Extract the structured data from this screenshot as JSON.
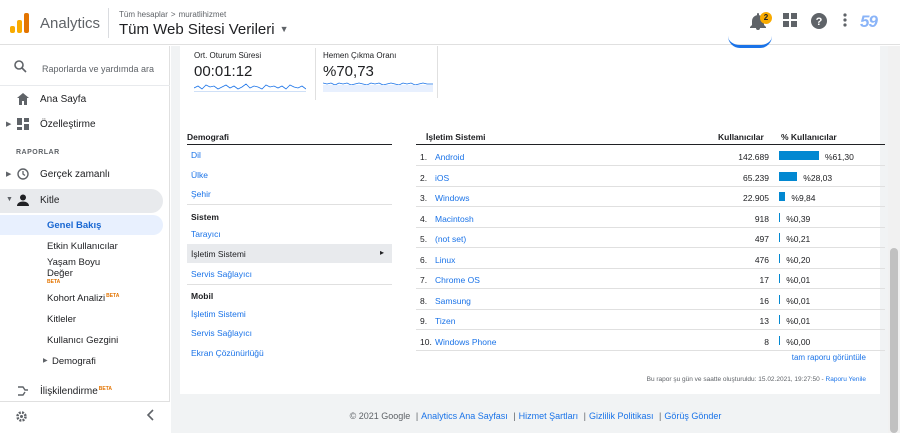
{
  "topbar": {
    "app_name": "Analytics",
    "breadcrumb": [
      "Tüm hesaplar",
      "muratlihizmet"
    ],
    "breadcrumb_separator": ">",
    "property": "Tüm Web Sitesi Verileri",
    "notification_count": "2",
    "account_badge": "59",
    "icons": [
      "bell-icon",
      "apps-grid-icon",
      "help-icon",
      "more-vert-icon"
    ]
  },
  "sidebar": {
    "search_placeholder": "Raporlarda ve yardımda ara",
    "items": [
      {
        "label": "Ana Sayfa",
        "icon": "home-icon"
      },
      {
        "label": "Özelleştirme",
        "icon": "dashboard-icon"
      }
    ],
    "section_label": "RAPORLAR",
    "reports": [
      {
        "label": "Gerçek zamanlı",
        "icon": "clock-icon"
      },
      {
        "label": "Kitle",
        "icon": "person-icon"
      }
    ],
    "kitle_sub": [
      {
        "label": "Genel Bakış"
      },
      {
        "label": "Etkin Kullanıcılar"
      },
      {
        "label": "Yaşam Boyu"
      },
      {
        "label": "Değer"
      },
      {
        "label": "Kohort Analizi"
      },
      {
        "label": "Kitleler"
      },
      {
        "label": "Kullanıcı Gezgini"
      },
      {
        "label": "Demografi"
      }
    ],
    "beta": "BETA",
    "attribution": "İlişkilendirme"
  },
  "metrics": [
    {
      "label": "Ort. Oturum Süresi",
      "value": "00:01:12"
    },
    {
      "label": "Hemen Çıkma Oranı",
      "value": "%70,73"
    }
  ],
  "dimensions": {
    "header": "Demografi",
    "demografi": [
      "Dil",
      "Ülke",
      "Şehir"
    ],
    "sistem_label": "Sistem",
    "sistem": [
      "Tarayıcı",
      "İşletim Sistemi",
      "Servis Sağlayıcı"
    ],
    "mobil_label": "Mobil",
    "mobil": [
      "İşletim Sistemi",
      "Servis Sağlayıcı",
      "Ekran Çözünürlüğü"
    ]
  },
  "table": {
    "col_name": "İşletim Sistemi",
    "col_users": "Kullanıcılar",
    "col_pct": "% Kullanıcılar",
    "rows": [
      {
        "n": "1.",
        "name": "Android",
        "users": "142.689",
        "pct": "%61,30",
        "share": 61.3
      },
      {
        "n": "2.",
        "name": "iOS",
        "users": "65.239",
        "pct": "%28,03",
        "share": 28.03
      },
      {
        "n": "3.",
        "name": "Windows",
        "users": "22.905",
        "pct": "%9,84",
        "share": 9.84
      },
      {
        "n": "4.",
        "name": "Macintosh",
        "users": "918",
        "pct": "%0,39",
        "share": 0.39
      },
      {
        "n": "5.",
        "name": "(not set)",
        "users": "497",
        "pct": "%0,21",
        "share": 0.21
      },
      {
        "n": "6.",
        "name": "Linux",
        "users": "476",
        "pct": "%0,20",
        "share": 0.2
      },
      {
        "n": "7.",
        "name": "Chrome OS",
        "users": "17",
        "pct": "%0,01",
        "share": 0.01
      },
      {
        "n": "8.",
        "name": "Samsung",
        "users": "16",
        "pct": "%0,01",
        "share": 0.01
      },
      {
        "n": "9.",
        "name": "Tizen",
        "users": "13",
        "pct": "%0,01",
        "share": 0.01
      },
      {
        "n": "10.",
        "name": "Windows Phone",
        "users": "8",
        "pct": "%0,00",
        "share": 0.0
      }
    ],
    "full_report": "tam raporu görüntüle",
    "generated_note": "Bu rapor şu gün ve saatte oluşturuldu: 15.02.2021, 19:27:50 -",
    "refresh_link": "Raporu Yenile"
  },
  "footer": {
    "copyright": "© 2021 Google",
    "links": [
      "Analytics Ana Sayfası",
      "Hizmet Şartları",
      "Gizlilik Politikası",
      "Görüş Gönder"
    ]
  },
  "colors": {
    "accent": "#1a73e8",
    "bar": "#0288d1",
    "logo_light": "#f9ab00",
    "logo_dark": "#e37400"
  }
}
